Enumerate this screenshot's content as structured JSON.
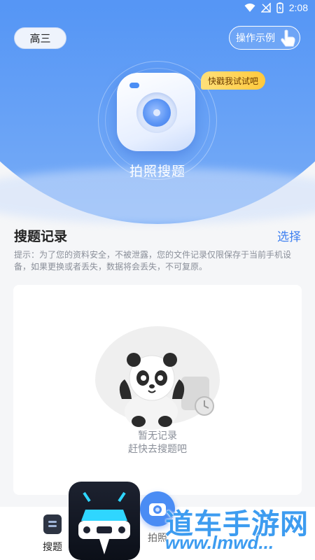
{
  "status_bar": {
    "time": "2:08"
  },
  "header": {
    "grade_label": "高三",
    "demo_label": "操作示例",
    "bubble_text": "快戳我试试吧",
    "title": "拍照搜题"
  },
  "history": {
    "title": "搜题记录",
    "select_label": "选择",
    "notice": "提示：为了您的资料安全，不被泄露，您的文件记录仅限保存于当前手机设备，如果更换或者丢失，数据将会丢失，不可复原。",
    "empty_line1": "暂无记录",
    "empty_line2": "赶快去搜题吧"
  },
  "bottom_nav": {
    "items": [
      {
        "label": "搜题",
        "icon": "document-icon"
      },
      {
        "label": "拍照",
        "icon": "camera-icon"
      }
    ]
  },
  "watermark": {
    "text": "道车手游网",
    "url": "www.lmwd..."
  },
  "colors": {
    "primary": "#3d86f3",
    "accent_link": "#3d7ff0",
    "bubble": "#ffc93d"
  }
}
